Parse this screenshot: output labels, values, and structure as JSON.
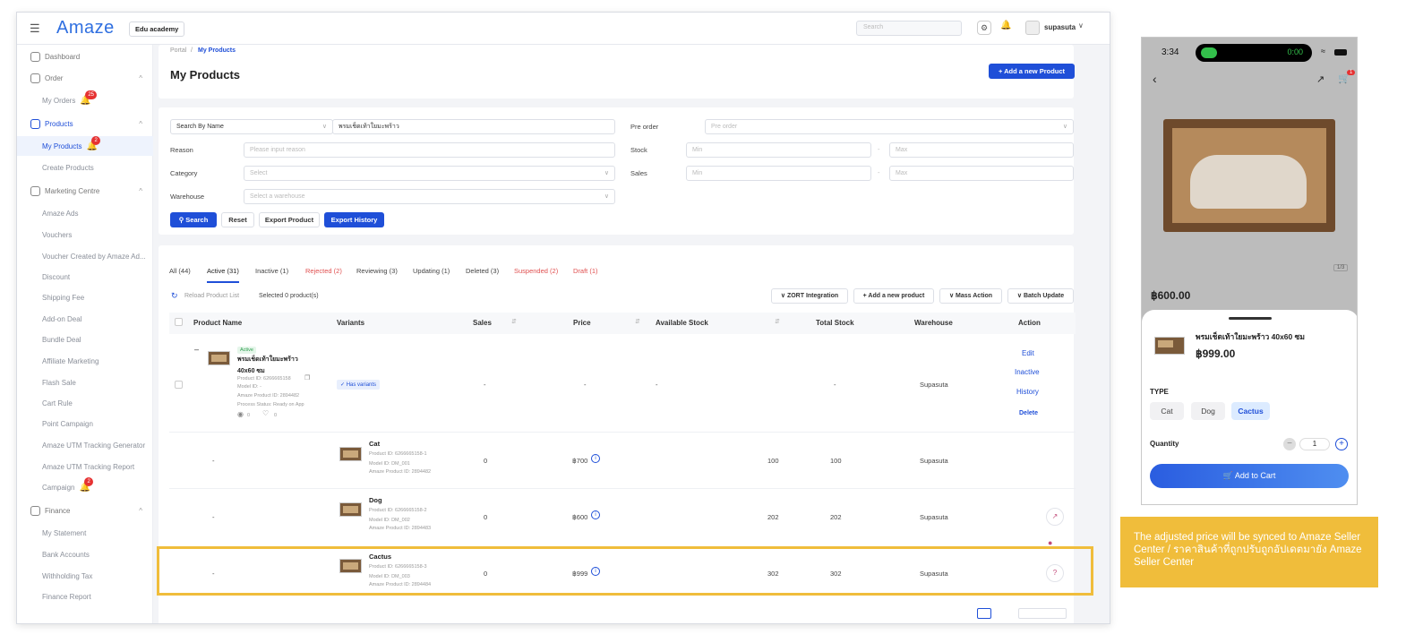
{
  "app": {
    "brand": "Amaze",
    "workspace": "Edu academy",
    "search_placeholder": "Search",
    "user_name": "supasuta"
  },
  "sidebar": {
    "items": [
      {
        "label": "Dashboard",
        "type": "section",
        "icon": "dashboard-icon"
      },
      {
        "label": "Order",
        "type": "section",
        "icon": "order-icon",
        "chevron": "^"
      },
      {
        "label": "My Orders",
        "type": "sub",
        "badge": "25"
      },
      {
        "label": "Products",
        "type": "section-active",
        "icon": "products-icon",
        "chevron": "^"
      },
      {
        "label": "My Products",
        "type": "sub-active",
        "badge": "2"
      },
      {
        "label": "Create Products",
        "type": "sub"
      },
      {
        "label": "Marketing Centre",
        "type": "section",
        "icon": "gift-icon",
        "chevron": "^"
      },
      {
        "label": "Amaze Ads",
        "type": "sub"
      },
      {
        "label": "Vouchers",
        "type": "sub"
      },
      {
        "label": "Voucher Created by Amaze Ad...",
        "type": "sub"
      },
      {
        "label": "Discount",
        "type": "sub"
      },
      {
        "label": "Shipping Fee",
        "type": "sub"
      },
      {
        "label": "Add-on Deal",
        "type": "sub"
      },
      {
        "label": "Bundle Deal",
        "type": "sub"
      },
      {
        "label": "Affiliate Marketing",
        "type": "sub"
      },
      {
        "label": "Flash Sale",
        "type": "sub"
      },
      {
        "label": "Cart Rule",
        "type": "sub"
      },
      {
        "label": "Point Campaign",
        "type": "sub"
      },
      {
        "label": "Amaze UTM Tracking Generator",
        "type": "sub"
      },
      {
        "label": "Amaze UTM Tracking Report",
        "type": "sub"
      },
      {
        "label": "Campaign",
        "type": "sub",
        "badge": "2"
      },
      {
        "label": "Finance",
        "type": "section",
        "icon": "finance-icon",
        "chevron": "^"
      },
      {
        "label": "My Statement",
        "type": "sub"
      },
      {
        "label": "Bank Accounts",
        "type": "sub"
      },
      {
        "label": "Withholding Tax",
        "type": "sub"
      },
      {
        "label": "Finance Report",
        "type": "sub"
      }
    ]
  },
  "page": {
    "breadcrumb_root": "Portal",
    "breadcrumb_sep": "/",
    "breadcrumb_current": "My Products",
    "title": "My Products",
    "add_product": "Add a new Product"
  },
  "filters": {
    "search_by": "Search By Name",
    "search_value": "พรมเช็ดเท้าใยมะพร้าว",
    "pre_order_label": "Pre order",
    "pre_order_placeholder": "Pre order",
    "reason_label": "Reason",
    "reason_placeholder": "Please input reason",
    "stock_label": "Stock",
    "min_placeholder": "Min",
    "max_placeholder": "Max",
    "range_sep": "-",
    "category_label": "Category",
    "category_placeholder": "Select",
    "sales_label": "Sales",
    "warehouse_label": "Warehouse",
    "warehouse_placeholder": "Select a warehouse",
    "search_btn": "Search",
    "reset_btn": "Reset",
    "export_btn": "Export Product",
    "export_history_btn": "Export History"
  },
  "tabs": [
    {
      "label": "All (44)",
      "state": "normal"
    },
    {
      "label": "Active (31)",
      "state": "active"
    },
    {
      "label": "Inactive (1)",
      "state": "normal"
    },
    {
      "label": "Rejected (2)",
      "state": "red"
    },
    {
      "label": "Reviewing (3)",
      "state": "normal"
    },
    {
      "label": "Updating (1)",
      "state": "normal"
    },
    {
      "label": "Deleted (3)",
      "state": "normal"
    },
    {
      "label": "Suspended (2)",
      "state": "red"
    },
    {
      "label": "Draft (1)",
      "state": "red"
    }
  ],
  "toolbar": {
    "reload": "Reload Product List",
    "selected": "Selected 0 product(s)",
    "zort": "ZORT Integration",
    "add_new": "Add a new product",
    "mass_action": "Mass Action",
    "batch_update": "Batch Update"
  },
  "table": {
    "headers": {
      "name": "Product Name",
      "variants": "Variants",
      "sales": "Sales",
      "price": "Price",
      "available": "Available Stock",
      "total": "Total Stock",
      "warehouse": "Warehouse",
      "action": "Action"
    },
    "product": {
      "status": "Active",
      "name_line1": "พรมเช็ดเท้าใยมะพร้าว",
      "name_line2": "40x60 ซม",
      "product_id": "Product ID: 6266665158",
      "model_id": "Model ID: -",
      "amaze_id": "Amaze Product ID: 2894482",
      "process_status": "Process Status: Ready on App",
      "views": "0",
      "likes": "0",
      "variants_badge": "Has variants",
      "sales": "-",
      "price": "-",
      "available": "-",
      "total": "-",
      "warehouse": "Supasuta",
      "actions": [
        "Edit",
        "Inactive",
        "History",
        "Delete"
      ]
    },
    "variant_rows": [
      {
        "dash": "-",
        "name": "Cat",
        "product_id": "Product ID: 6266665158-1",
        "model_id": "Model ID: DM_001",
        "amaze_id": "Amaze Product ID: 2894482",
        "sales": "0",
        "price": "฿700",
        "available": "100",
        "total": "100",
        "warehouse": "Supasuta"
      },
      {
        "dash": "-",
        "name": "Dog",
        "product_id": "Product ID: 6266665158-2",
        "model_id": "Model ID: DM_002",
        "amaze_id": "Amaze Product ID: 2894483",
        "sales": "0",
        "price": "฿600",
        "available": "202",
        "total": "202",
        "warehouse": "Supasuta"
      },
      {
        "dash": "-",
        "name": "Cactus",
        "product_id": "Product ID: 6266665158-3",
        "model_id": "Model ID: DM_003",
        "amaze_id": "Amaze Product ID: 2894484",
        "sales": "0",
        "price": "฿999",
        "available": "302",
        "total": "302",
        "warehouse": "Supasuta"
      }
    ]
  },
  "phone": {
    "time": "3:34",
    "call_time": "0:00",
    "cart_badge": "1",
    "bg_price": "฿600.00",
    "image_counter": "1/3",
    "sheet_title": "พรมเช็ดเท้าใยมะพร้าว 40x60 ซม",
    "sheet_price": "฿999.00",
    "type_label": "TYPE",
    "types": [
      "Cat",
      "Dog",
      "Cactus"
    ],
    "selected_type": "Cactus",
    "quantity_label": "Quantity",
    "quantity": "1",
    "add_to_cart": "Add to Cart"
  },
  "note": {
    "text": "The adjusted price will be synced to Amaze Seller Center / ราคาสินค้าที่ถูกปรับถูกอัปเดตมายัง Amaze Seller Center"
  },
  "colors": {
    "primary": "#1f4fd8",
    "highlight": "#f0bd3b",
    "danger": "#e63232",
    "active_green": "#2e9e4f"
  }
}
